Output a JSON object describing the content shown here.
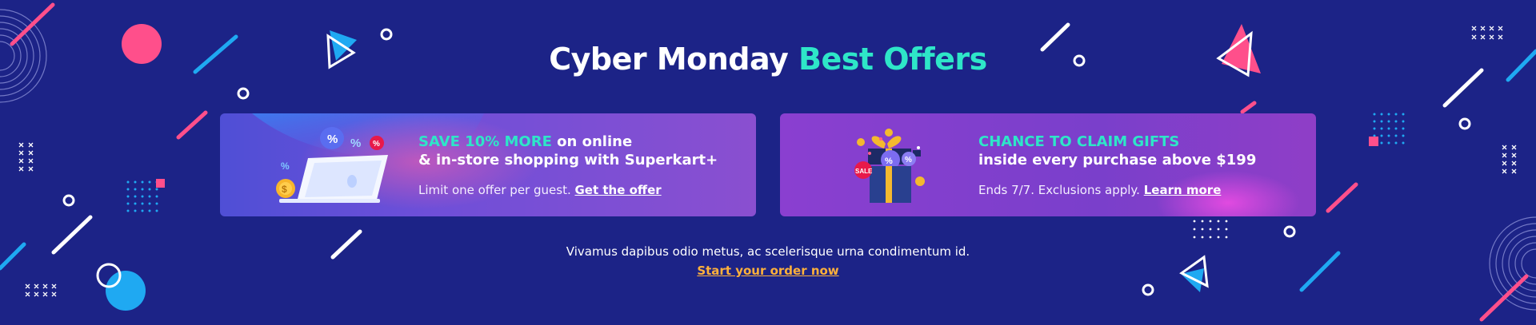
{
  "banner": {
    "title": {
      "main": "Cyber Monday",
      "accent": "Best Offers"
    },
    "colors": {
      "background": "#1c2387",
      "accent": "#2ee6c8",
      "cta": "#ffb13b",
      "pink": "#ff4f8b",
      "blue": "#1fa9f2"
    }
  },
  "offers": [
    {
      "headline_accent": "SAVE 10% MORE",
      "headline_rest": " on online",
      "headline_line2": "& in-store shopping with Superkart+",
      "sub_text": "Limit one offer per guest. ",
      "link_label": "Get the offer",
      "icon": "laptop-discount-icon"
    },
    {
      "headline_accent": "CHANCE TO CLAIM GIFTS",
      "headline_line2": "inside every purchase above $199",
      "sub_text": "Ends 7/7. Exclusions apply. ",
      "link_label": "Learn more",
      "icon": "gift-box-icon",
      "badge": "SALE"
    }
  ],
  "footer": {
    "text": "Vivamus dapibus odio metus, ac scelerisque urna condimentum id.",
    "cta_label": "Start your order now"
  }
}
